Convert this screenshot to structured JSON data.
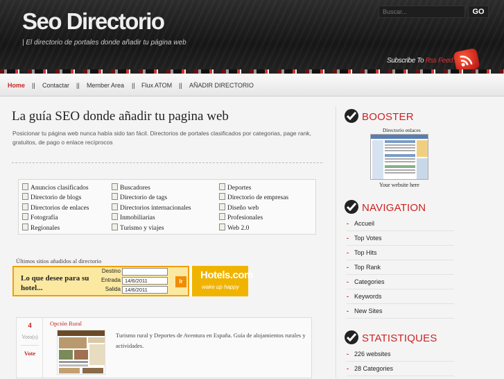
{
  "header": {
    "logo": "Seo Directorio",
    "tagline": "| El directorio de portales donde añadir tu página web",
    "search_placeholder": "Buscar...",
    "search_button": "GO",
    "subscribe_prefix": "Subscribe To ",
    "subscribe_highlight": "Rss Feed:"
  },
  "nav": [
    "Home",
    "||",
    "Contactar",
    "||",
    "Member Area",
    "||",
    "Flux ATOM",
    "||",
    "AÑADIR DIRECTORIO"
  ],
  "main": {
    "title": "La guía SEO donde añadir tu pagina web",
    "intro": "Posicionar tu página web nunca había sido tan fácil. Directorios de portales clasificados por categorias, page rank, gratuitos, de pago o enlace recíprocos"
  },
  "categories": [
    [
      "Anuncios clasificados",
      "Buscadores",
      "Deportes"
    ],
    [
      "Directorio de blogs",
      "Directorio de tags",
      "Directorio de empresas"
    ],
    [
      "Directorios de enlaces",
      "Directorios internacionales",
      "Diseño web"
    ],
    [
      "Fotografía",
      "Inmobiliarias",
      "Profesionales"
    ],
    [
      "Regionales",
      "Turismo y viajes",
      "Web 2.0"
    ]
  ],
  "recent_label": "Últimos sitios añadidos al directorio",
  "hotel_widget": {
    "question": "Lo que desee para su hotel...",
    "destino_label": "Destino",
    "destino_value": "",
    "entrada_label": "Entrada",
    "entrada_value": "14/6/2011",
    "salida_label": "Salida",
    "salida_value": "14/6/2011",
    "go_label": "Ir",
    "brand": "Hotels.com",
    "brand_slogan": "wake up happy"
  },
  "entry": {
    "votes": "4",
    "votes_label": "Voto(s)",
    "vote_button": "Vote",
    "title": "Opción Rural",
    "description": "Turismo rural y Deportes de Aventura en España. Guía de alojamientos rurales y actividades."
  },
  "sidebar": {
    "booster": {
      "heading": "BOOSTER",
      "caption": "Directorio enlaces",
      "subcaption": "Your website here"
    },
    "navigation": {
      "heading": "NAVIGATION",
      "items": [
        "Accueil",
        "Top Votes",
        "Top Hits",
        "Top Rank",
        "Categories",
        "Keywords",
        "New Sites"
      ]
    },
    "stats": {
      "heading": "STATISTIQUES",
      "items": [
        "226 websites",
        "28 Categories"
      ]
    }
  },
  "colors": {
    "accent": "#cc2222",
    "header_bg": "#1c1c1c",
    "hotels_bg": "#f0b400"
  }
}
